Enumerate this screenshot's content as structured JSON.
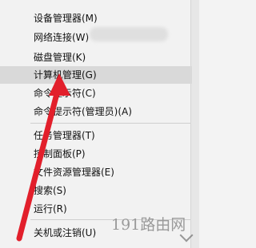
{
  "menu": {
    "items": [
      "设备管理器(M)",
      "网络连接(W)",
      "磁盘管理(K)",
      "计算机管理(G)",
      "命令提示符(C)",
      "命令提示符(管理员)(A)",
      "任务管理器(T)",
      "控制面板(P)",
      "文件资源管理器(E)",
      "搜索(S)",
      "运行(R)",
      "关机或注销(U)"
    ],
    "highlighted_index": 3
  },
  "watermark": "191路由网",
  "colors": {
    "arrow": "#e21f2b",
    "highlight": "#d9d9d9",
    "menu_bg": "#f2f2f2"
  }
}
